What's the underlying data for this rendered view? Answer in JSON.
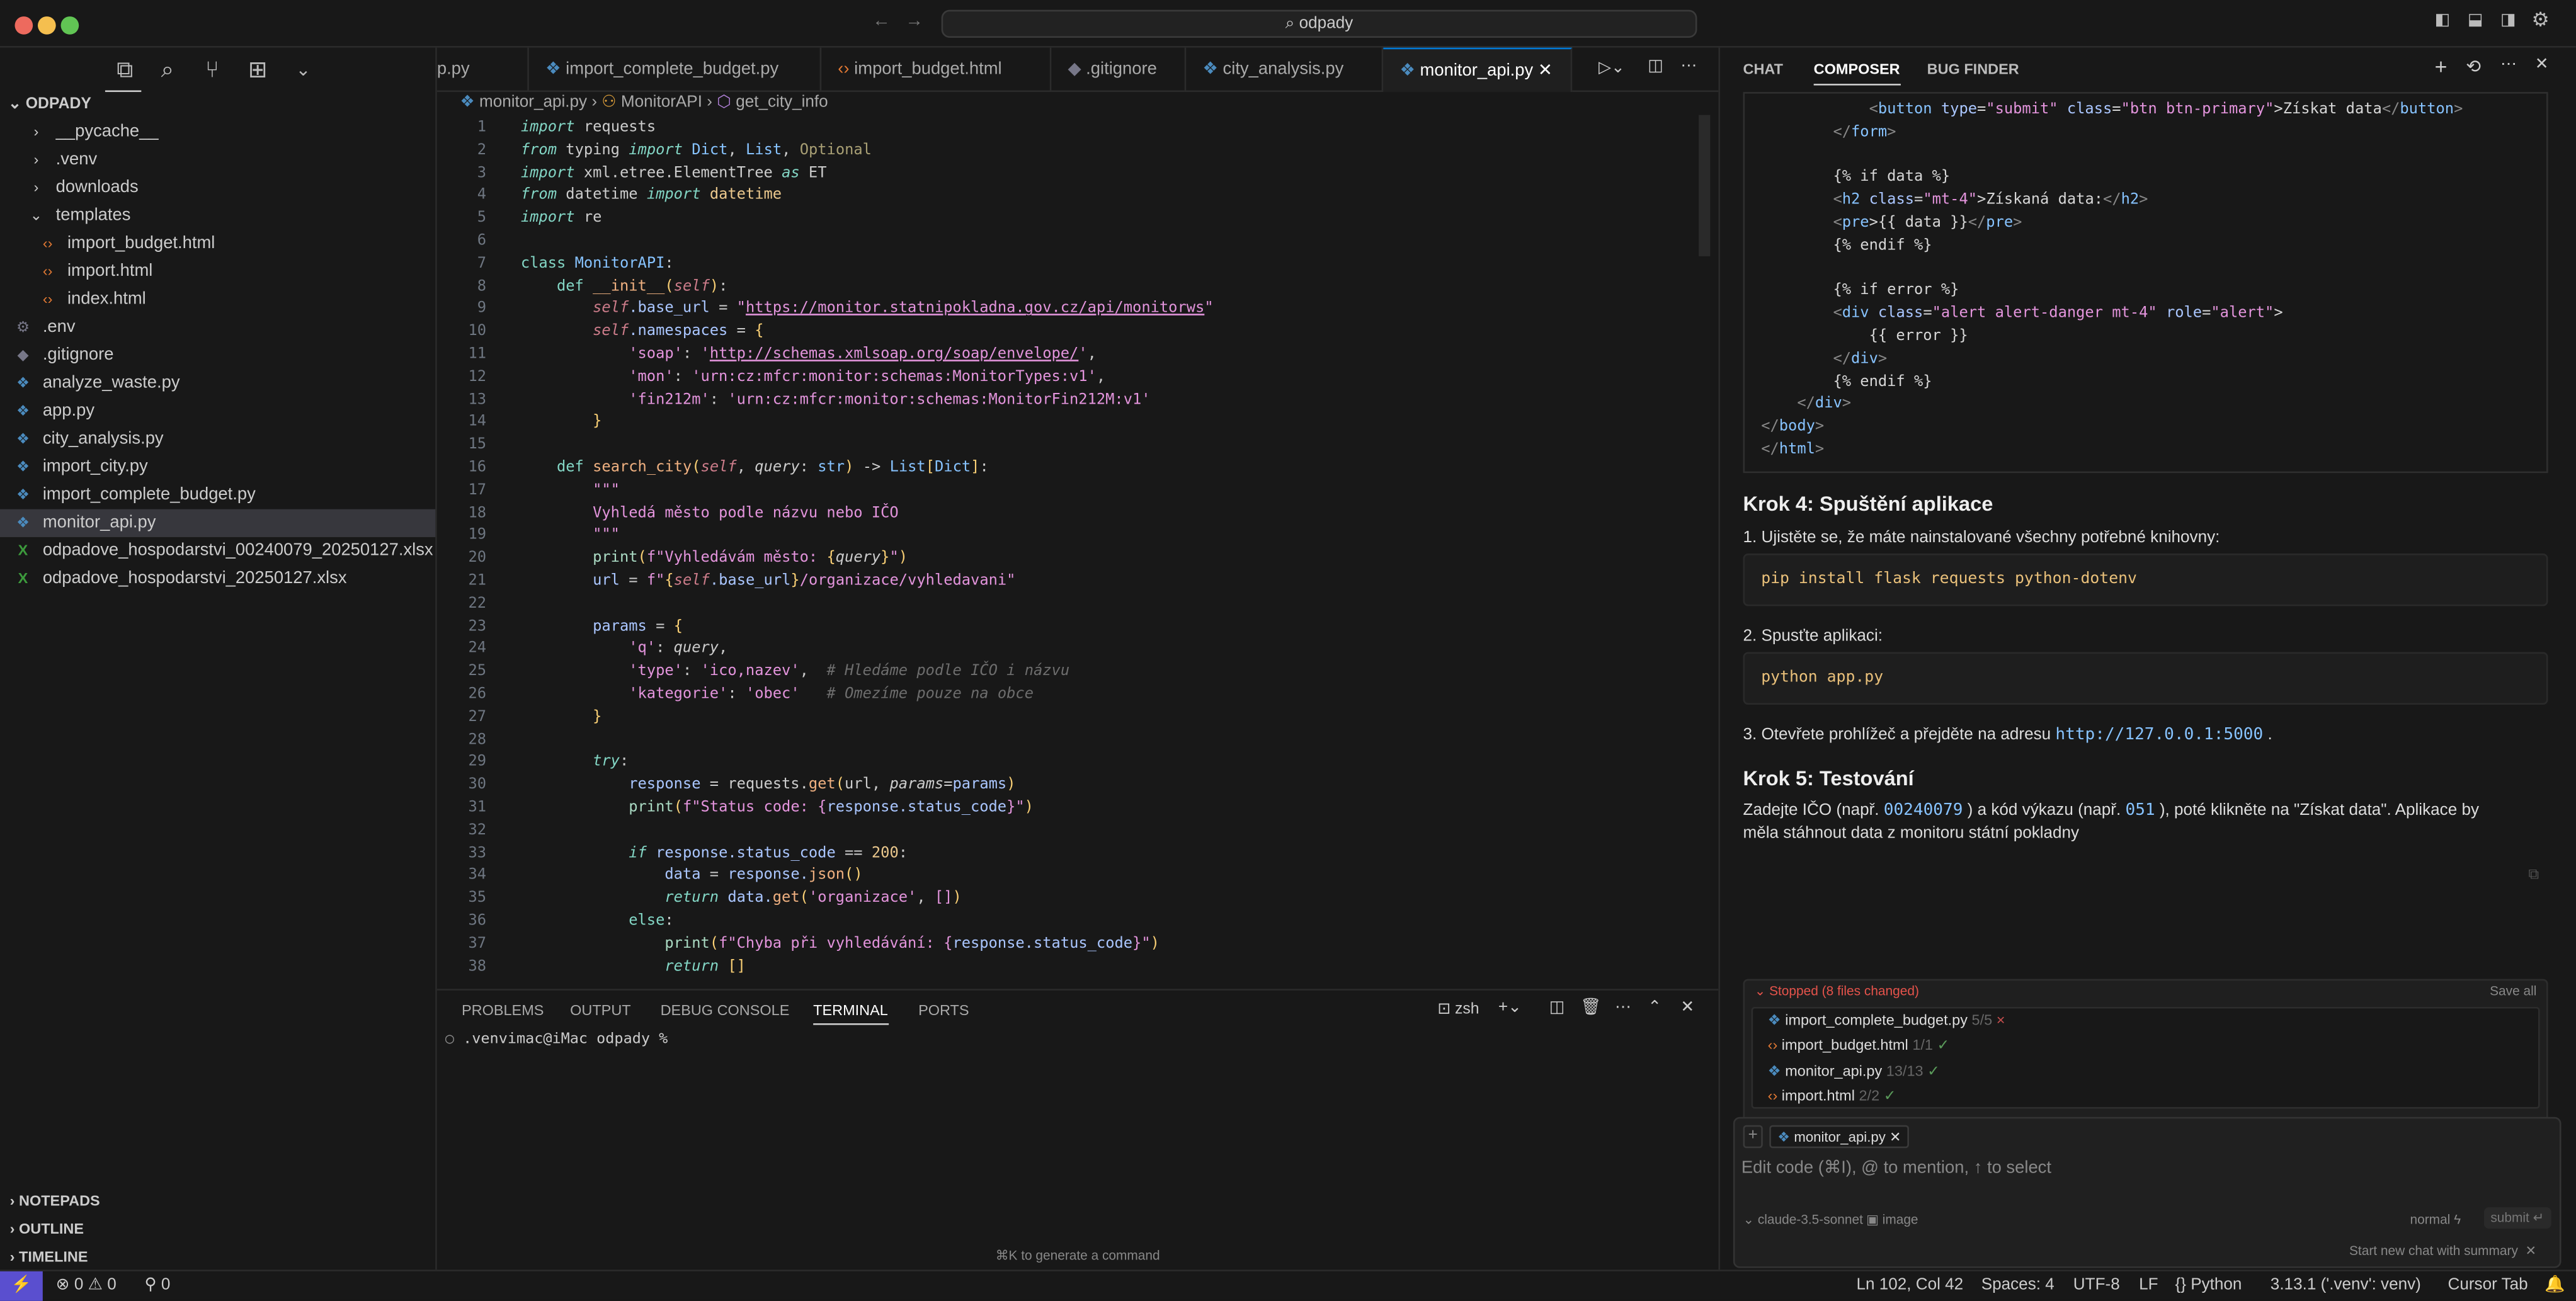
{
  "window": {
    "search": "odpady"
  },
  "sidebar": {
    "root": "ODPADY",
    "items": [
      {
        "label": "__pycache__",
        "kind": "folder",
        "depth": 1,
        "open": false
      },
      {
        "label": ".venv",
        "kind": "folder",
        "depth": 1,
        "open": false
      },
      {
        "label": "downloads",
        "kind": "folder",
        "depth": 1,
        "open": false
      },
      {
        "label": "templates",
        "kind": "folder",
        "depth": 1,
        "open": true
      },
      {
        "label": "import_budget.html",
        "kind": "html",
        "depth": 2
      },
      {
        "label": "import.html",
        "kind": "html",
        "depth": 2
      },
      {
        "label": "index.html",
        "kind": "html",
        "depth": 2
      },
      {
        "label": ".env",
        "kind": "gear",
        "depth": 1
      },
      {
        "label": ".gitignore",
        "kind": "git",
        "depth": 1
      },
      {
        "label": "analyze_waste.py",
        "kind": "py",
        "depth": 1
      },
      {
        "label": "app.py",
        "kind": "py",
        "depth": 1
      },
      {
        "label": "city_analysis.py",
        "kind": "py",
        "depth": 1
      },
      {
        "label": "import_city.py",
        "kind": "py",
        "depth": 1
      },
      {
        "label": "import_complete_budget.py",
        "kind": "py",
        "depth": 1
      },
      {
        "label": "monitor_api.py",
        "kind": "py",
        "depth": 1,
        "selected": true
      },
      {
        "label": "odpadove_hospodarstvi_00240079_20250127.xlsx",
        "kind": "xl",
        "depth": 1
      },
      {
        "label": "odpadove_hospodarstvi_20250127.xlsx",
        "kind": "xl",
        "depth": 1
      }
    ],
    "sections": [
      "NOTEPADS",
      "OUTLINE",
      "TIMELINE"
    ]
  },
  "editor": {
    "tabs": [
      {
        "label": "p.py",
        "kind": "none"
      },
      {
        "label": "import_complete_budget.py",
        "kind": "py"
      },
      {
        "label": "import_budget.html",
        "kind": "html"
      },
      {
        "label": ".gitignore",
        "kind": "git"
      },
      {
        "label": "city_analysis.py",
        "kind": "py"
      },
      {
        "label": "monitor_api.py",
        "kind": "py",
        "active": true
      }
    ],
    "breadcrumb": [
      "monitor_api.py",
      "MonitorAPI",
      "get_city_info"
    ],
    "lines": [
      [
        [
          "import",
          "k"
        ],
        [
          " requests",
          ""
        ]
      ],
      [
        [
          "from",
          "k"
        ],
        [
          " typing ",
          ""
        ],
        [
          "import",
          "k"
        ],
        [
          " ",
          ""
        ],
        [
          "Dict",
          "ty"
        ],
        [
          ", ",
          ""
        ],
        [
          "List",
          "ty"
        ],
        [
          ", ",
          ""
        ],
        [
          "Optional",
          "opt"
        ]
      ],
      [
        [
          "import",
          "k"
        ],
        [
          " xml.etree.ElementTree ",
          ""
        ],
        [
          "as",
          "k"
        ],
        [
          " ET",
          ""
        ]
      ],
      [
        [
          "from",
          "k"
        ],
        [
          " datetime ",
          ""
        ],
        [
          "import",
          "k"
        ],
        [
          " ",
          ""
        ],
        [
          "datetime",
          "num"
        ]
      ],
      [
        [
          "import",
          "k"
        ],
        [
          " re",
          ""
        ]
      ],
      [],
      [
        [
          "class",
          "kw"
        ],
        [
          " ",
          ""
        ],
        [
          "MonitorAPI",
          "cls"
        ],
        [
          ":",
          ""
        ]
      ],
      [
        [
          "    def",
          "kw"
        ],
        [
          " ",
          ""
        ],
        [
          "__init__",
          "fn"
        ],
        [
          "(",
          "br"
        ],
        [
          "self",
          "slf"
        ],
        [
          ")",
          "br"
        ],
        [
          ":",
          ""
        ]
      ],
      [
        [
          "        self",
          "slf"
        ],
        [
          ".base_url",
          "var"
        ],
        [
          " = ",
          ""
        ],
        [
          "\"",
          "s"
        ],
        [
          "https://monitor.statnipokladna.gov.cz/api/monitorws",
          "u"
        ],
        [
          "\"",
          "s"
        ]
      ],
      [
        [
          "        self",
          "slf"
        ],
        [
          ".namespaces",
          "var"
        ],
        [
          " = ",
          ""
        ],
        [
          "{",
          "br"
        ]
      ],
      [
        [
          "            'soap'",
          "s"
        ],
        [
          ": ",
          ""
        ],
        [
          "'",
          "s"
        ],
        [
          "http://schemas.xmlsoap.org/soap/envelope/",
          "u"
        ],
        [
          "'",
          "s"
        ],
        [
          ",",
          ""
        ]
      ],
      [
        [
          "            'mon'",
          "s"
        ],
        [
          ": ",
          ""
        ],
        [
          "'urn:cz:mfcr:monitor:schemas:MonitorTypes:v1'",
          "s"
        ],
        [
          ",",
          ""
        ]
      ],
      [
        [
          "            'fin212m'",
          "s"
        ],
        [
          ": ",
          ""
        ],
        [
          "'urn:cz:mfcr:monitor:schemas:MonitorFin212M:v1'",
          "s"
        ]
      ],
      [
        [
          "        }",
          "br"
        ]
      ],
      [],
      [
        [
          "    def",
          "kw"
        ],
        [
          " ",
          ""
        ],
        [
          "search_city",
          "fn"
        ],
        [
          "(",
          "br"
        ],
        [
          "self",
          "slf"
        ],
        [
          ", ",
          ""
        ],
        [
          "query",
          "it"
        ],
        [
          ": ",
          ""
        ],
        [
          "str",
          "ty"
        ],
        [
          ")",
          "br"
        ],
        [
          " -> ",
          ""
        ],
        [
          "List",
          "ty"
        ],
        [
          "[",
          "br"
        ],
        [
          "Dict",
          "ty"
        ],
        [
          "]",
          "br"
        ],
        [
          ":",
          ""
        ]
      ],
      [
        [
          "        \"\"\"",
          "s"
        ]
      ],
      [
        [
          "        Vyhledá město podle názvu nebo IČO",
          "s"
        ]
      ],
      [
        [
          "        \"\"\"",
          "s"
        ]
      ],
      [
        [
          "        print",
          "fc"
        ],
        [
          "(",
          "br"
        ],
        [
          "f\"Vyhledávám město: ",
          "s"
        ],
        [
          "{",
          "br"
        ],
        [
          "query",
          "it"
        ],
        [
          "}",
          "br"
        ],
        [
          "\"",
          "s"
        ],
        [
          ")",
          "br"
        ]
      ],
      [
        [
          "        url",
          "var"
        ],
        [
          " = ",
          ""
        ],
        [
          "f\"",
          "s"
        ],
        [
          "{",
          "br"
        ],
        [
          "self",
          "slf"
        ],
        [
          ".base_url",
          "var"
        ],
        [
          "}",
          "br"
        ],
        [
          "/organizace/vyhledavani\"",
          "s"
        ]
      ],
      [],
      [
        [
          "        params",
          "var"
        ],
        [
          " = ",
          ""
        ],
        [
          "{",
          "br"
        ]
      ],
      [
        [
          "            'q'",
          "s"
        ],
        [
          ": ",
          ""
        ],
        [
          "query",
          "it"
        ],
        [
          ",",
          ""
        ]
      ],
      [
        [
          "            'type'",
          "s"
        ],
        [
          ": ",
          ""
        ],
        [
          "'ico,nazev'",
          "s"
        ],
        [
          ",  ",
          ""
        ],
        [
          "# Hledáme podle IČO i názvu",
          "cm"
        ]
      ],
      [
        [
          "            'kategorie'",
          "s"
        ],
        [
          ": ",
          ""
        ],
        [
          "'obec'",
          "s"
        ],
        [
          "   ",
          ""
        ],
        [
          "# Omezíme pouze na obce",
          "cm"
        ]
      ],
      [
        [
          "        }",
          "br"
        ]
      ],
      [],
      [
        [
          "        try",
          "k"
        ],
        [
          ":",
          ""
        ]
      ],
      [
        [
          "            response",
          "var"
        ],
        [
          " = requests.",
          ""
        ],
        [
          "get",
          "fn"
        ],
        [
          "(",
          "br"
        ],
        [
          "url",
          ""
        ],
        [
          ", ",
          ""
        ],
        [
          "params",
          "it"
        ],
        [
          "=",
          ""
        ],
        [
          "params",
          "var"
        ],
        [
          ")",
          "br"
        ]
      ],
      [
        [
          "            print",
          "fc"
        ],
        [
          "(",
          "br"
        ],
        [
          "f\"Status code: ",
          "s"
        ],
        [
          "{",
          "s"
        ],
        [
          "response.status_code",
          "var"
        ],
        [
          "}\"",
          "s"
        ],
        [
          ")",
          "br"
        ]
      ],
      [],
      [
        [
          "            if",
          "k"
        ],
        [
          " ",
          ""
        ],
        [
          "response.status_code",
          "var"
        ],
        [
          " == ",
          ""
        ],
        [
          "200",
          "num"
        ],
        [
          ":",
          ""
        ]
      ],
      [
        [
          "                data",
          "var"
        ],
        [
          " = ",
          ""
        ],
        [
          "response.",
          "var"
        ],
        [
          "json",
          "fn"
        ],
        [
          "()",
          "br"
        ]
      ],
      [
        [
          "                return",
          "k"
        ],
        [
          " ",
          ""
        ],
        [
          "data.",
          "var"
        ],
        [
          "get",
          "fn"
        ],
        [
          "(",
          "br"
        ],
        [
          "'organizace'",
          "s"
        ],
        [
          ", ",
          ""
        ],
        [
          "[]",
          "s"
        ],
        [
          ")",
          "br"
        ]
      ],
      [
        [
          "            else",
          "kw"
        ],
        [
          ":",
          ""
        ]
      ],
      [
        [
          "                print",
          "fc"
        ],
        [
          "(",
          "br"
        ],
        [
          "f\"Chyba při vyhledávání: ",
          "s"
        ],
        [
          "{",
          "s"
        ],
        [
          "response.status_code",
          "var"
        ],
        [
          "}\"",
          "s"
        ],
        [
          ")",
          "br"
        ]
      ],
      [
        [
          "                return",
          "k"
        ],
        [
          " ",
          ""
        ],
        [
          "[]",
          "br"
        ]
      ]
    ]
  },
  "panel": {
    "tabs": [
      "PROBLEMS",
      "OUTPUT",
      "DEBUG CONSOLE",
      "TERMINAL",
      "PORTS"
    ],
    "active_tab": "TERMINAL",
    "shell": "zsh",
    "prompt": ".venvimac@iMac odpady %",
    "hint": "⌘K to generate a command"
  },
  "chat": {
    "tabs": [
      "CHAT",
      "COMPOSER",
      "BUG FINDER"
    ],
    "active_tab": "COMPOSER",
    "code": [
      [
        [
          "            <",
          "pu"
        ],
        [
          "button",
          "tg"
        ],
        [
          " type",
          "at"
        ],
        [
          "=",
          ""
        ],
        [
          "\"submit\"",
          "av"
        ],
        [
          " class",
          "at"
        ],
        [
          "=",
          ""
        ],
        [
          "\"btn btn-primary\"",
          "av"
        ],
        [
          ">",
          ""
        ],
        [
          "Získat data",
          ""
        ],
        [
          "</",
          "pu"
        ],
        [
          "button",
          "tg"
        ],
        [
          ">",
          "pu"
        ]
      ],
      [
        [
          "        </",
          "pu"
        ],
        [
          "form",
          "tg"
        ],
        [
          ">",
          "pu"
        ]
      ],
      [],
      [
        [
          "        {% if data %}",
          ""
        ]
      ],
      [
        [
          "        <",
          "pu"
        ],
        [
          "h2",
          "tg"
        ],
        [
          " class",
          "at"
        ],
        [
          "=",
          ""
        ],
        [
          "\"mt-4\"",
          "av"
        ],
        [
          ">",
          ""
        ],
        [
          "Získaná data:",
          ""
        ],
        [
          "</",
          "pu"
        ],
        [
          "h2",
          "tg"
        ],
        [
          ">",
          "pu"
        ]
      ],
      [
        [
          "        <",
          "pu"
        ],
        [
          "pre",
          "tg"
        ],
        [
          ">",
          ""
        ],
        [
          "{{ data }}",
          ""
        ],
        [
          "</",
          "pu"
        ],
        [
          "pre",
          "tg"
        ],
        [
          ">",
          "pu"
        ]
      ],
      [
        [
          "        {% endif %}",
          ""
        ]
      ],
      [],
      [
        [
          "        {% if error %}",
          ""
        ]
      ],
      [
        [
          "        <",
          "pu"
        ],
        [
          "div",
          "tg"
        ],
        [
          " class",
          "at"
        ],
        [
          "=",
          ""
        ],
        [
          "\"alert alert-danger mt-4\"",
          "av"
        ],
        [
          " role",
          "at"
        ],
        [
          "=",
          ""
        ],
        [
          "\"alert\"",
          "av"
        ],
        [
          ">",
          ""
        ]
      ],
      [
        [
          "            {{ error }}",
          ""
        ]
      ],
      [
        [
          "        </",
          "pu"
        ],
        [
          "div",
          "tg"
        ],
        [
          ">",
          "pu"
        ]
      ],
      [
        [
          "        {% endif %}",
          ""
        ]
      ],
      [
        [
          "    </",
          "pu"
        ],
        [
          "div",
          "tg"
        ],
        [
          ">",
          "pu"
        ]
      ],
      [
        [
          "</",
          "pu"
        ],
        [
          "body",
          "tg"
        ],
        [
          ">",
          "pu"
        ]
      ],
      [
        [
          "</",
          "pu"
        ],
        [
          "html",
          "tg"
        ],
        [
          ">",
          "pu"
        ]
      ]
    ],
    "step4": {
      "title": "Krok 4: Spuštění aplikace",
      "item1": "1. Ujistěte se, že máte nainstalované všechny potřebné knihovny:",
      "cmd1": "pip install flask requests python-dotenv",
      "item2": "2. Spusťte aplikaci:",
      "cmd2": "python app.py",
      "item3_pre": "3. Otevřete prohlížeč a přejděte na adresu",
      "item3_url": "http://127.0.0.1:5000",
      "item3_post": "."
    },
    "step5": {
      "title": "Krok 5: Testování",
      "t1": "Zadejte IČO (např.",
      "ico": "00240079",
      "t2": ") a kód výkazu (např.",
      "code": "051",
      "t3": "), poté klikněte na \"Získat data\". Aplikace by",
      "line2": "měla stáhnout data z monitoru státní pokladny"
    },
    "changes": {
      "status": "Stopped (8 files changed)",
      "save_all": "Save all",
      "files": [
        {
          "name": "import_complete_budget.py",
          "kind": "py",
          "count": "5/5",
          "state": "rejected",
          "mark": "×"
        },
        {
          "name": "import_budget.html",
          "kind": "html",
          "count": "1/1",
          "state": "accepted",
          "mark": "✓"
        },
        {
          "name": "monitor_api.py",
          "kind": "py",
          "count": "13/13",
          "state": "accepted",
          "mark": "✓"
        },
        {
          "name": "import.html",
          "kind": "html",
          "count": "2/2",
          "state": "accepted",
          "mark": "✓"
        }
      ]
    },
    "input": {
      "context_file": "monitor_api.py",
      "placeholder": "Edit code (⌘I), @ to mention, ↑ to select",
      "model": "claude-3.5-sonnet",
      "image": "image",
      "mode": "normal",
      "submit": "submit ↵"
    },
    "new_chat": "Start new chat with summary"
  },
  "status": {
    "errors": "0",
    "warnings": "0",
    "ports": "0",
    "position": "Ln 102, Col 42",
    "spaces": "Spaces: 4",
    "encoding": "UTF-8",
    "eol": "LF",
    "language": "Python",
    "interpreter": "3.13.1 ('.venv': venv)",
    "cursor_tab": "Cursor Tab"
  },
  "colors": {
    "accent": "#0078d4",
    "remote": "#5a4fcf",
    "stopped": "#e5534b",
    "python": "#4b8bbe",
    "html": "#e37933"
  }
}
